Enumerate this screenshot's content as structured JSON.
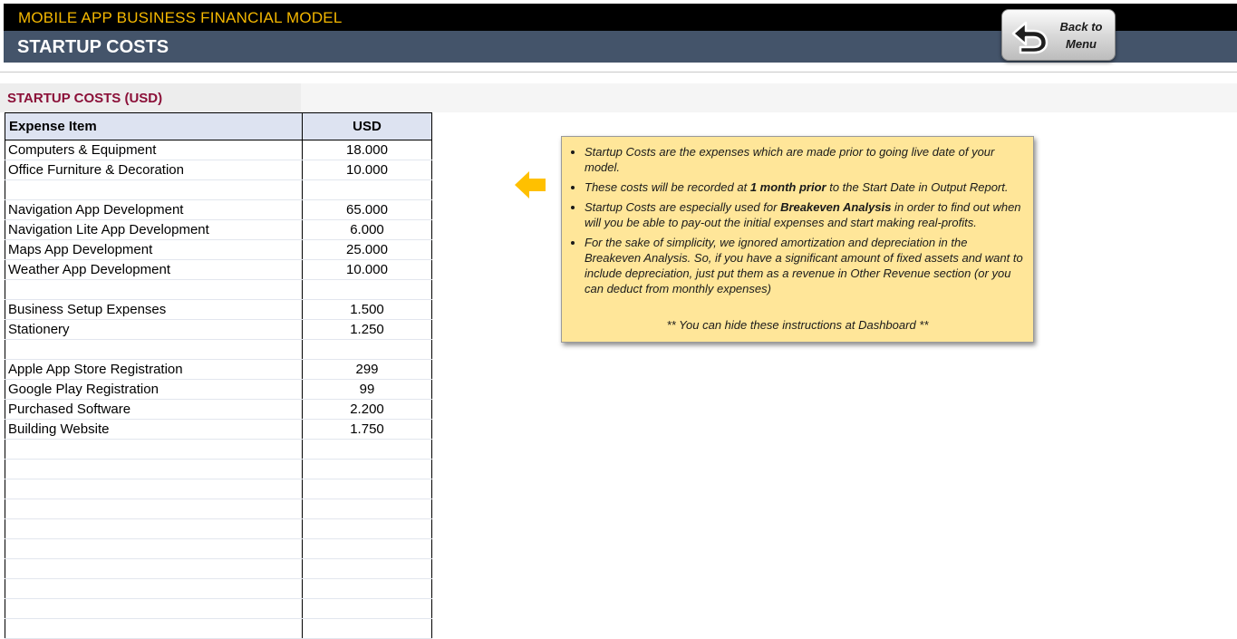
{
  "header": {
    "app_title": "MOBILE APP BUSINESS FINANCIAL MODEL",
    "page_title": "STARTUP COSTS",
    "back_button_label": "Back to\nMenu"
  },
  "section": {
    "title": "STARTUP COSTS (USD)"
  },
  "table": {
    "columns": [
      "Expense Item",
      "USD"
    ],
    "rows": [
      {
        "item": "Computers & Equipment",
        "usd": "18.000"
      },
      {
        "item": "Office Furniture & Decoration",
        "usd": "10.000"
      },
      {
        "item": "",
        "usd": ""
      },
      {
        "item": "Navigation App Development",
        "usd": "65.000"
      },
      {
        "item": "Navigation Lite App Development",
        "usd": "6.000"
      },
      {
        "item": "Maps App Development",
        "usd": "25.000"
      },
      {
        "item": "Weather App Development",
        "usd": "10.000"
      },
      {
        "item": "",
        "usd": ""
      },
      {
        "item": "Business Setup Expenses",
        "usd": "1.500"
      },
      {
        "item": "Stationery",
        "usd": "1.250"
      },
      {
        "item": "",
        "usd": ""
      },
      {
        "item": "Apple App Store Registration",
        "usd": "299"
      },
      {
        "item": "Google Play Registration",
        "usd": "99"
      },
      {
        "item": "Purchased Software",
        "usd": "2.200"
      },
      {
        "item": "Building Website",
        "usd": "1.750"
      },
      {
        "item": "",
        "usd": ""
      },
      {
        "item": "",
        "usd": ""
      },
      {
        "item": "",
        "usd": ""
      },
      {
        "item": "",
        "usd": ""
      },
      {
        "item": "",
        "usd": ""
      },
      {
        "item": "",
        "usd": ""
      },
      {
        "item": "",
        "usd": ""
      },
      {
        "item": "",
        "usd": ""
      },
      {
        "item": "",
        "usd": ""
      },
      {
        "item": "",
        "usd": ""
      }
    ]
  },
  "notes": {
    "bullets": [
      [
        {
          "text": "Startup Costs are the expenses which are made prior to going live date of your model."
        }
      ],
      [
        {
          "text": "These costs will be recorded at "
        },
        {
          "text": "1 month prior",
          "bold": true
        },
        {
          "text": " to the Start Date in Output Report."
        }
      ],
      [
        {
          "text": "Startup Costs are especially used for "
        },
        {
          "text": "Breakeven Analysis",
          "bold": true
        },
        {
          "text": " in order to find out when will you be able to pay-out the initial expenses and start making real-profits."
        }
      ],
      [
        {
          "text": "For the sake of simplicity, we ignored amortization and depreciation in the Breakeven Analysis. So, if you have a significant amount of fixed assets and want to include depreciation, just put them as a revenue in Other Revenue section (or you can deduct from monthly expenses)"
        }
      ]
    ],
    "footer": "** You can hide these instructions at Dashboard **"
  },
  "colors": {
    "title_bar": "#000000",
    "title_text": "#f5b800",
    "subtitle_bar": "#44546a",
    "section_title": "#8b1038",
    "table_header": "#dde3f1",
    "notes_background": "#ffe699",
    "arrow": "#ffc000"
  },
  "icons": {
    "back_button": "back-arrow-icon",
    "pointer": "left-arrow-icon"
  }
}
